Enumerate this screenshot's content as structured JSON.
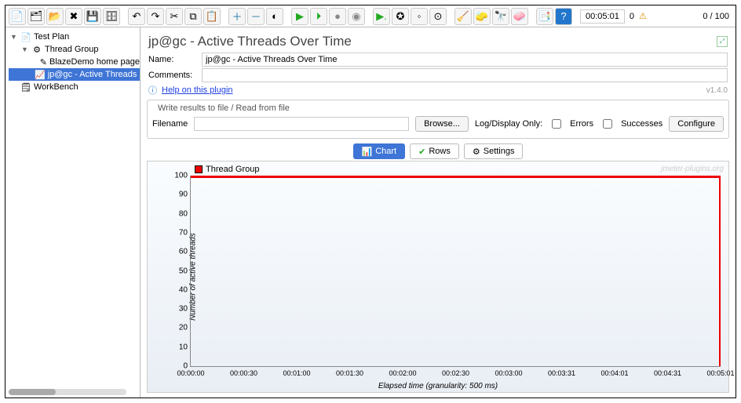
{
  "toolbar": {
    "time": "00:05:01",
    "warnings": "0",
    "counter": "0 / 100"
  },
  "tree": {
    "items": [
      {
        "label": "Test Plan",
        "indent": 0,
        "caret": "▼",
        "icon": "📄",
        "sel": false
      },
      {
        "label": "Thread Group",
        "indent": 1,
        "caret": "▼",
        "icon": "⚙",
        "sel": false
      },
      {
        "label": "BlazeDemo home page",
        "indent": 2,
        "caret": "",
        "icon": "✎",
        "sel": false
      },
      {
        "label": "jp@gc - Active Threads Over Time",
        "indent": 2,
        "caret": "",
        "icon": "📈",
        "sel": true
      },
      {
        "label": "WorkBench",
        "indent": 0,
        "caret": "",
        "icon": "🗒",
        "sel": false
      }
    ]
  },
  "main": {
    "title": "jp@gc - Active Threads Over Time",
    "name_label": "Name:",
    "name_value": "jp@gc - Active Threads Over Time",
    "comments_label": "Comments:",
    "help_link": "Help on this plugin",
    "version": "v1.4.0",
    "panel_title": "Write results to file / Read from file",
    "filename_label": "Filename",
    "browse": "Browse...",
    "logdisplay": "Log/Display Only:",
    "errors": "Errors",
    "successes": "Successes",
    "configure": "Configure",
    "tabs": {
      "chart": "Chart",
      "rows": "Rows",
      "settings": "Settings"
    },
    "legend": "Thread Group",
    "watermark": "jmeter-plugins.org",
    "ylabel": "Number of active threads",
    "xlabel": "Elapsed time (granularity: 500 ms)"
  },
  "chart_data": {
    "type": "line",
    "title": "jp@gc - Active Threads Over Time",
    "xlabel": "Elapsed time (granularity: 500 ms)",
    "ylabel": "Number of active threads",
    "ylim": [
      0,
      100
    ],
    "series": [
      {
        "name": "Thread Group",
        "color": "#ee0000",
        "x": [
          "00:00:00",
          "00:00:30",
          "00:01:00",
          "00:01:30",
          "00:02:00",
          "00:02:30",
          "00:03:00",
          "00:03:31",
          "00:04:01",
          "00:04:31",
          "00:05:01"
        ],
        "y": [
          100,
          100,
          100,
          100,
          100,
          100,
          100,
          100,
          100,
          100,
          0
        ]
      }
    ],
    "yticks": [
      0,
      10,
      20,
      30,
      40,
      50,
      60,
      70,
      80,
      90,
      100
    ],
    "xticks": [
      "00:00:00",
      "00:00:30",
      "00:01:00",
      "00:01:30",
      "00:02:00",
      "00:02:30",
      "00:03:00",
      "00:03:31",
      "00:04:01",
      "00:04:31",
      "00:05:01"
    ]
  }
}
